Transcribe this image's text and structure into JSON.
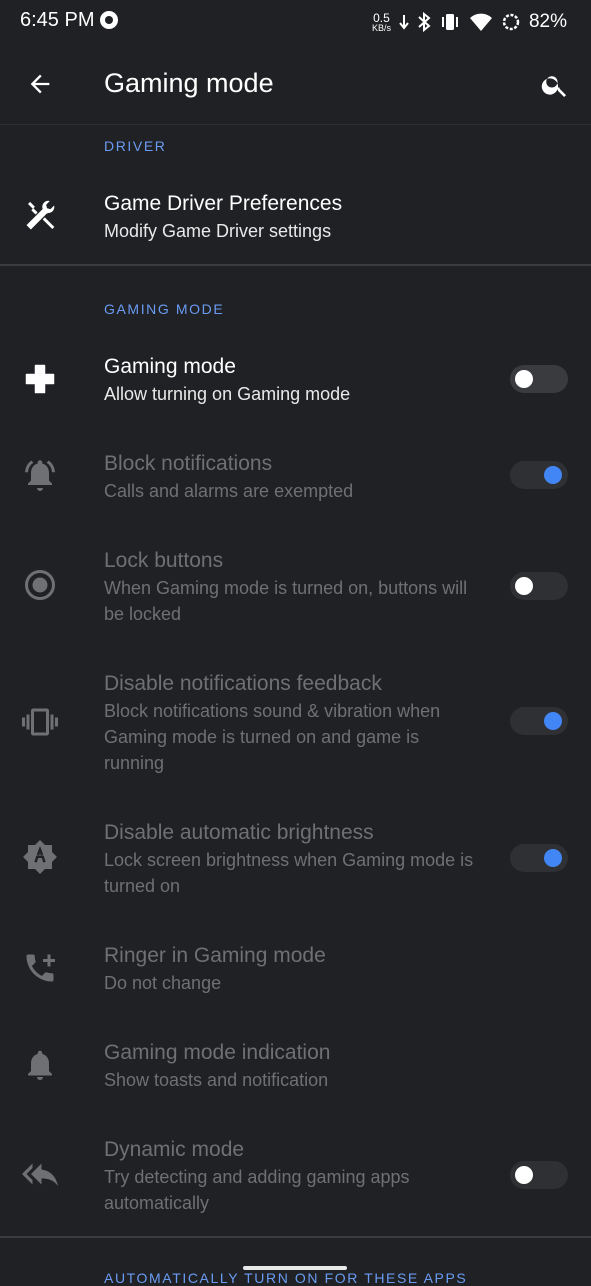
{
  "status_bar": {
    "time": "6:45 PM",
    "net_speed_value": "0.5",
    "net_speed_unit": "KB/s",
    "battery": "82%"
  },
  "toolbar": {
    "title": "Gaming mode"
  },
  "sections": {
    "driver_header": "DRIVER",
    "gaming_header": "GAMING MODE",
    "auto_header": "AUTOMATICALLY TURN ON FOR THESE APPS"
  },
  "items": [
    {
      "title": "Game Driver Preferences",
      "summary": "Modify Game Driver settings",
      "icon": "hammer-wrench-icon",
      "enabled": true
    },
    {
      "title": "Gaming mode",
      "summary": "Allow turning on Gaming mode",
      "icon": "dpad-icon",
      "enabled": true,
      "switch_on": false
    },
    {
      "title": "Block notifications",
      "summary": "Calls and alarms are exempted",
      "icon": "notifications-active-icon",
      "enabled": false,
      "switch_on": true
    },
    {
      "title": "Lock buttons",
      "summary": "When Gaming mode is turned on, buttons will be locked",
      "icon": "radio-button-icon",
      "enabled": false,
      "switch_on": false
    },
    {
      "title": "Disable notifications feedback",
      "summary": "Block notifications sound & vibration when Gaming mode is turned on and game is running",
      "icon": "vibration-icon",
      "enabled": false,
      "switch_on": true
    },
    {
      "title": "Disable automatic brightness",
      "summary": "Lock screen brightness when Gaming mode is turned on",
      "icon": "brightness-auto-icon",
      "enabled": false,
      "switch_on": true
    },
    {
      "title": "Ringer in Gaming mode",
      "summary": "Do not change",
      "icon": "phone-add-icon",
      "enabled": false
    },
    {
      "title": "Gaming mode indication",
      "summary": "Show toasts and notification",
      "icon": "bell-icon",
      "enabled": false
    },
    {
      "title": "Dynamic mode",
      "summary": "Try detecting and adding gaming apps automatically",
      "icon": "reply-all-icon",
      "enabled": false,
      "switch_on": false
    }
  ],
  "colors": {
    "background": "#202124",
    "accent": "#4285f4",
    "section_header": "#6a9bf2",
    "disabled_text": "#6f7073"
  }
}
